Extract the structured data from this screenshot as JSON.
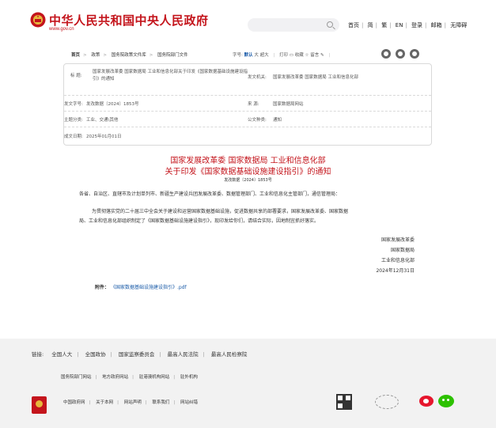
{
  "header": {
    "site_title": "中华人民共和国中央人民政府",
    "site_url": "www.gov.cn",
    "nav": [
      "首页",
      "简",
      "繁",
      "EN",
      "登录",
      "邮箱",
      "无障碍"
    ]
  },
  "crumb": {
    "items": [
      "首页",
      "政策",
      "国务院政策文件库",
      "国务院部门文件"
    ],
    "font_label": "字号:",
    "font_sizes": [
      "默认",
      "大",
      "超大"
    ],
    "print": "打印",
    "favorite": "收藏",
    "bookmark": "留言"
  },
  "meta": {
    "title_label": "标 题:",
    "title_value": "国家发展改革委 国家数据局 工业和信息化部关于印发《国家数据基础设施建设指引》的通知",
    "issuer_label": "发文机关:",
    "issuer_value": "国家发展改革委 国家数据局 工业和信息化部",
    "docno_label": "发文字号:",
    "docno_value": "发改数据〔2024〕1853号",
    "source_label": "来 源:",
    "source_value": "国家数据局网站",
    "topic_label": "主题分类:",
    "topic_value": "工业、交通\\其他",
    "type_label": "公文种类:",
    "type_value": "通知",
    "date_label": "成文日期:",
    "date_value": "2025年01月01日"
  },
  "doc": {
    "title_line1": "国家发展改革委 国家数据局 工业和信息化部",
    "title_line2": "关于印发《国家数据基础设施建设指引》的通知",
    "doc_number": "发改数据〔2024〕1853号",
    "addressee": "各省、自治区、直辖市及计划单列市、新疆生产建设兵团发展改革委、数据管理部门、工业和信息化主管部门，通信管理局：",
    "body_line1": "为贯彻落实党的二十届三中全会关于建设和运营国家数据基础设施，促进数据共享的部署要求，国家发展改革委、国家数据",
    "body_line2": "局、工业和信息化部组织制定了《国家数据基础设施建设指引》，现印发给你们，请结合实际，因地制宜抓好落实。",
    "signers": [
      "国家发展改革委",
      "国家数据局",
      "工业和信息化部",
      "2024年12月31日"
    ],
    "attachment_label": "附件：",
    "attachment_link": "《国家数据基础设施建设指引》.pdf"
  },
  "footer": {
    "links_label": "链接:",
    "links": [
      "全国人大",
      "全国政协",
      "国家监察委员会",
      "最高人民法院",
      "最高人民检察院"
    ],
    "sub_links": [
      "国务院部门网站",
      "地方政府网站",
      "驻港澳机构网站",
      "驻外机构"
    ],
    "bottom_links": [
      "中国政府网",
      "关于本网",
      "网站声明",
      "联系我们",
      "网站纠错"
    ]
  }
}
